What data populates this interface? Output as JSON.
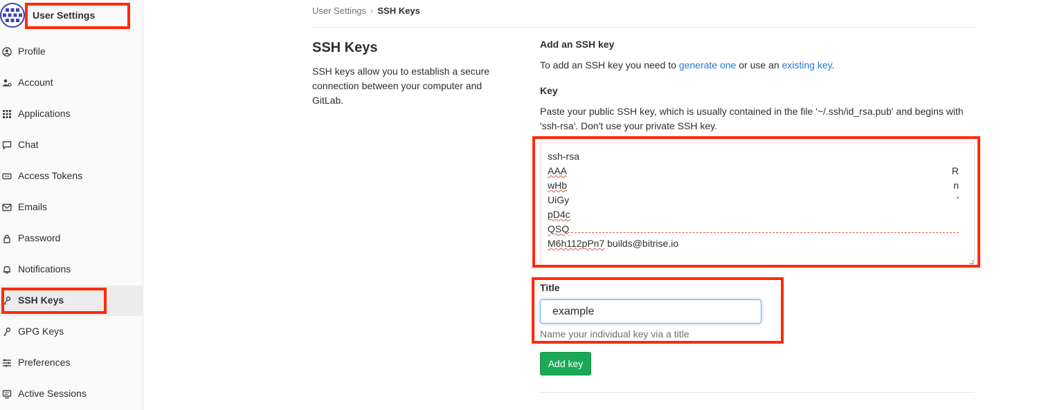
{
  "sidebar": {
    "title": "User Settings",
    "items": [
      {
        "label": "Profile",
        "icon": "profile-icon"
      },
      {
        "label": "Account",
        "icon": "account-icon"
      },
      {
        "label": "Applications",
        "icon": "applications-icon"
      },
      {
        "label": "Chat",
        "icon": "chat-icon"
      },
      {
        "label": "Access Tokens",
        "icon": "access-tokens-icon"
      },
      {
        "label": "Emails",
        "icon": "email-icon"
      },
      {
        "label": "Password",
        "icon": "lock-icon"
      },
      {
        "label": "Notifications",
        "icon": "bell-icon"
      },
      {
        "label": "SSH Keys",
        "icon": "key-icon",
        "active": true
      },
      {
        "label": "GPG Keys",
        "icon": "key-icon"
      },
      {
        "label": "Preferences",
        "icon": "preferences-icon"
      },
      {
        "label": "Active Sessions",
        "icon": "monitor-icon"
      }
    ]
  },
  "breadcrumb": {
    "parent": "User Settings",
    "separator": "›",
    "current": "SSH Keys"
  },
  "section": {
    "title": "SSH Keys",
    "description": "SSH keys allow you to establish a secure connection between your computer and GitLab."
  },
  "form": {
    "add_heading": "Add an SSH key",
    "add_text_prefix": "To add an SSH key you need to ",
    "generate_link": "generate one",
    "add_text_middle": " or use an ",
    "existing_link": "existing key",
    "add_text_suffix": ".",
    "key_heading": "Key",
    "key_help": "Paste your public SSH key, which is usually contained in the file '~/.ssh/id_rsa.pub' and begins with 'ssh-rsa'. Don't use your private SSH key.",
    "key_lines": [
      "ssh-rsa",
      "AAA",
      "wHb",
      "UiGy",
      "pD4c",
      "QSQ"
    ],
    "key_last_prefix": "M6h112pPn7",
    "key_last_suffix": " builds@bitrise.io",
    "key_tails": [
      "R",
      "n",
      "'"
    ],
    "title_label": "Title",
    "title_value": "example",
    "title_help": "Name your individual key via a title",
    "submit_label": "Add key"
  },
  "colors": {
    "link": "#1f78d1",
    "submit": "#1aaa55",
    "annotation": "#ff2a0a"
  }
}
